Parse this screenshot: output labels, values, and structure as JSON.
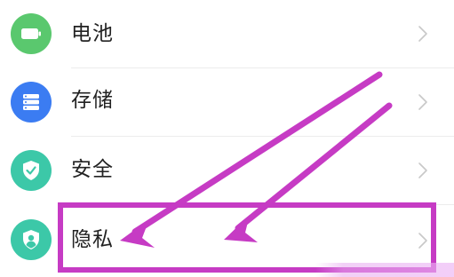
{
  "settings": {
    "items": [
      {
        "label": "电池",
        "icon": "battery-icon",
        "icon_color": "#5ac86e"
      },
      {
        "label": "存储",
        "icon": "storage-icon",
        "icon_color": "#3b7cf2"
      },
      {
        "label": "安全",
        "icon": "shield-check-icon",
        "icon_color": "#3cc8a8"
      },
      {
        "label": "隐私",
        "icon": "privacy-user-icon",
        "icon_color": "#3cc8a8"
      }
    ]
  },
  "annotation": {
    "color": "#c63bc4",
    "highlighted_item": "隐私"
  }
}
